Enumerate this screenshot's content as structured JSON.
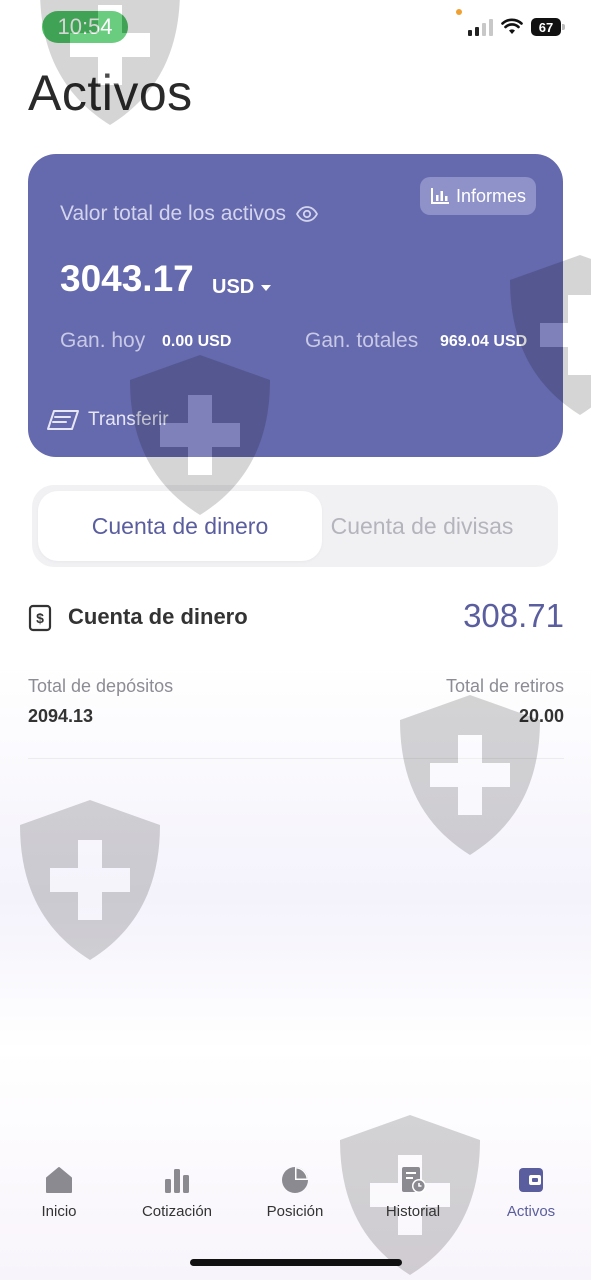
{
  "status_bar": {
    "time": "10:54",
    "battery": "67"
  },
  "page": {
    "title": "Activos"
  },
  "card": {
    "total_label": "Valor total de los activos",
    "reports_label": "Informes",
    "total_value": "3043.17",
    "currency": "USD",
    "gain_today_label": "Gan. hoy",
    "gain_today_value": "0.00 USD",
    "gain_total_label": "Gan. totales",
    "gain_total_value": "969.04 USD",
    "transfer_label": "Transferir",
    "bg_color": "#6569ad"
  },
  "tabs": [
    {
      "label": "Cuenta de dinero",
      "active": true
    },
    {
      "label": "Cuenta de divisas",
      "active": false
    }
  ],
  "account": {
    "title": "Cuenta de dinero",
    "balance": "308.71",
    "deposits_label": "Total de depósitos",
    "deposits_value": "2094.13",
    "withdrawals_label": "Total de retiros",
    "withdrawals_value": "20.00"
  },
  "nav": {
    "items": [
      {
        "label": "Inicio",
        "icon": "home-icon",
        "active": false
      },
      {
        "label": "Cotización",
        "icon": "bar-chart-icon",
        "active": false
      },
      {
        "label": "Posición",
        "icon": "pie-chart-icon",
        "active": false
      },
      {
        "label": "Historial",
        "icon": "history-icon",
        "active": false
      },
      {
        "label": "Activos",
        "icon": "wallet-icon",
        "active": true
      }
    ],
    "active_color": "#5a5e9e",
    "inactive_icon_color": "#8a8a90"
  }
}
